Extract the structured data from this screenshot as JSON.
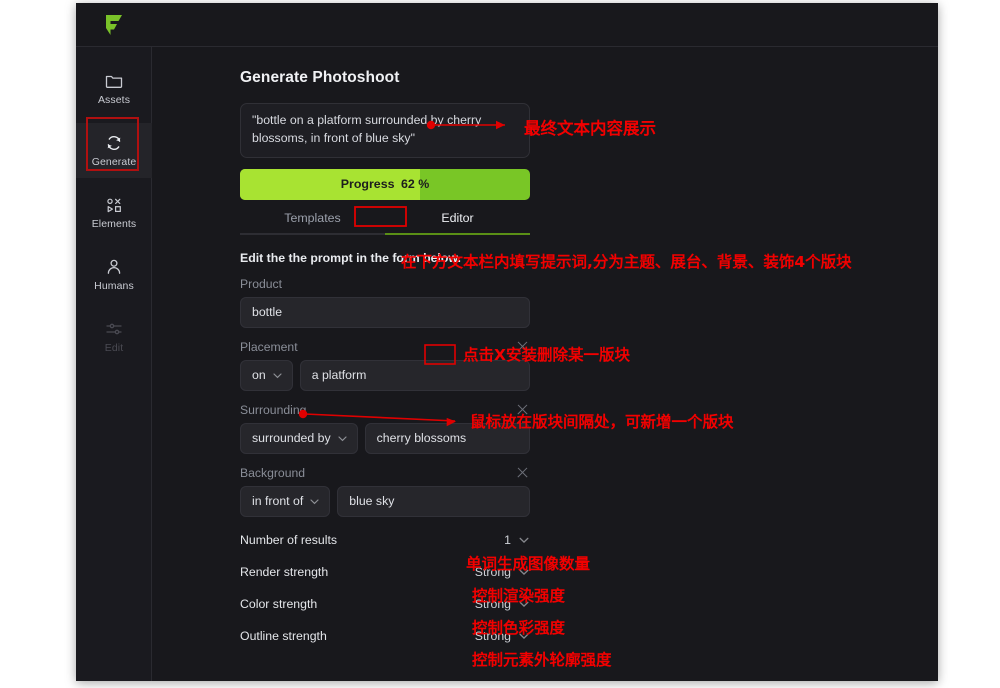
{
  "app": {
    "logo_icon": "flair-logo-icon",
    "title": "Generate Photoshoot"
  },
  "sidebar": {
    "items": [
      {
        "id": "assets",
        "label": "Assets",
        "icon": "folder-icon",
        "active": false,
        "disabled": false
      },
      {
        "id": "generate",
        "label": "Generate",
        "icon": "refresh-icon",
        "active": true,
        "disabled": false
      },
      {
        "id": "elements",
        "label": "Elements",
        "icon": "shapes-icon",
        "active": false,
        "disabled": false
      },
      {
        "id": "humans",
        "label": "Humans",
        "icon": "person-icon",
        "active": false,
        "disabled": false
      },
      {
        "id": "edit",
        "label": "Edit",
        "icon": "sliders-icon",
        "active": false,
        "disabled": true
      }
    ]
  },
  "main": {
    "prompt_preview": "\"bottle on a platform surrounded by cherry blossoms, in front of blue sky\"",
    "progress": {
      "label": "Progress",
      "value": 62,
      "unit": "%",
      "fill_color": "#a8e332",
      "track_color": "#79c626"
    },
    "tabs": [
      {
        "id": "templates",
        "label": "Templates",
        "active": false
      },
      {
        "id": "editor",
        "label": "Editor",
        "active": true
      }
    ],
    "form_hint": "Edit the the prompt in the form below.",
    "fields": [
      {
        "id": "product",
        "label": "Product",
        "has_close": false,
        "has_select": false,
        "value": "bottle"
      },
      {
        "id": "placement",
        "label": "Placement",
        "has_close": true,
        "has_select": true,
        "select_value": "on",
        "value": "a platform"
      },
      {
        "id": "surrounding",
        "label": "Surrounding",
        "has_close": true,
        "has_select": true,
        "select_value": "surrounded by",
        "value": "cherry blossoms"
      },
      {
        "id": "background",
        "label": "Background",
        "has_close": true,
        "has_select": true,
        "select_value": "in front of",
        "value": "blue sky"
      }
    ],
    "options": [
      {
        "id": "number-of-results",
        "name": "Number of results",
        "value": "1"
      },
      {
        "id": "render-strength",
        "name": "Render strength",
        "value": "Strong"
      },
      {
        "id": "color-strength",
        "name": "Color strength",
        "value": "Strong"
      },
      {
        "id": "outline-strength",
        "name": "Outline strength",
        "value": "Strong"
      }
    ]
  },
  "annotations": {
    "color": "#f20000",
    "notes": [
      {
        "id": "final-text",
        "text": "最终文本内容展示"
      },
      {
        "id": "fill-prompt",
        "text": "在下方文本栏内填写提示词,分为主题、展台、背景、装饰4个版块"
      },
      {
        "id": "click-x-delete",
        "text": "点击X安装删除某一版块"
      },
      {
        "id": "hover-add-block",
        "text": "鼠标放在版块间隔处，可新增一个版块"
      },
      {
        "id": "num-images",
        "text": "单词生成图像数量"
      },
      {
        "id": "render-strength-note",
        "text": "控制渲染强度"
      },
      {
        "id": "color-strength-note",
        "text": "控制色彩强度"
      },
      {
        "id": "outline-strength-note",
        "text": "控制元素外轮廓强度"
      }
    ]
  }
}
